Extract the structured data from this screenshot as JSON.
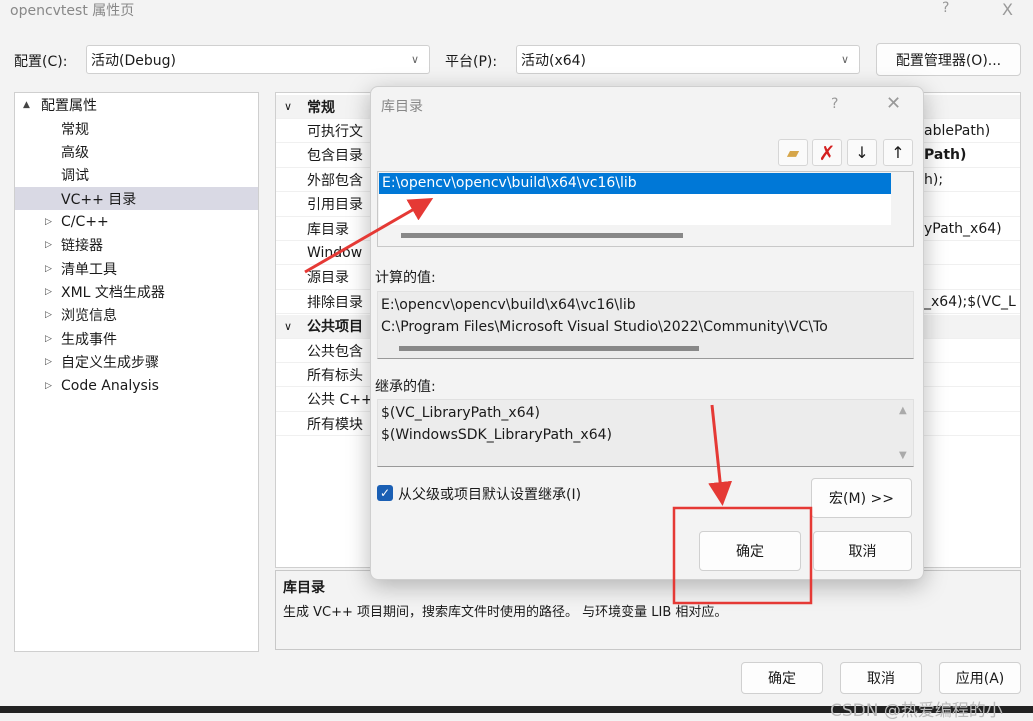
{
  "window": {
    "title": "opencvtest 属性页",
    "help": "?",
    "close": "X"
  },
  "toolbar": {
    "config_label": "配置(C):",
    "config_value": "活动(Debug)",
    "platform_label": "平台(P):",
    "platform_value": "活动(x64)",
    "config_manager": "配置管理器(O)..."
  },
  "tree": {
    "items": [
      {
        "label": "配置属性",
        "expander": "▲"
      },
      {
        "label": "常规",
        "expander": ""
      },
      {
        "label": "高级",
        "expander": ""
      },
      {
        "label": "调试",
        "expander": ""
      },
      {
        "label": "VC++ 目录",
        "expander": "",
        "selected": true
      },
      {
        "label": "C/C++",
        "expander": "▷"
      },
      {
        "label": "链接器",
        "expander": "▷"
      },
      {
        "label": "清单工具",
        "expander": "▷"
      },
      {
        "label": "XML 文档生成器",
        "expander": "▷"
      },
      {
        "label": "浏览信息",
        "expander": "▷"
      },
      {
        "label": "生成事件",
        "expander": "▷"
      },
      {
        "label": "自定义生成步骤",
        "expander": "▷"
      },
      {
        "label": "Code Analysis",
        "expander": "▷"
      }
    ]
  },
  "grid": {
    "rows": [
      {
        "name": "常规",
        "value": "",
        "header": true
      },
      {
        "name": "可执行文",
        "value": "ablePath)"
      },
      {
        "name": "包含目录",
        "value": "Path)",
        "bold": true
      },
      {
        "name": "外部包含",
        "value": "h);"
      },
      {
        "name": "引用目录",
        "value": ""
      },
      {
        "name": "库目录",
        "value": "yPath_x64)"
      },
      {
        "name": "Window",
        "value": ""
      },
      {
        "name": "源目录",
        "value": ""
      },
      {
        "name": "排除目录",
        "value": "_x64);$(VC_L"
      },
      {
        "name": "公共项目",
        "value": "",
        "header": true
      },
      {
        "name": "公共包含",
        "value": ""
      },
      {
        "name": "所有标头",
        "value": ""
      },
      {
        "name": "公共 C++",
        "value": ""
      },
      {
        "name": "所有模块",
        "value": ""
      }
    ]
  },
  "description": {
    "title": "库目录",
    "text": "生成 VC++ 项目期间，搜索库文件时使用的路径。 与环境变量 LIB 相对应。"
  },
  "buttons": {
    "ok": "确定",
    "cancel": "取消",
    "apply": "应用(A)"
  },
  "dialog": {
    "title": "库目录",
    "help": "?",
    "close": "✕",
    "entries": [
      "E:\\opencv\\opencv\\build\\x64\\vc16\\lib"
    ],
    "computed_label": "计算的值:",
    "computed": [
      "E:\\opencv\\opencv\\build\\x64\\vc16\\lib",
      "C:\\Program Files\\Microsoft Visual Studio\\2022\\Community\\VC\\To"
    ],
    "inherited_label": "继承的值:",
    "inherited": [
      "$(VC_LibraryPath_x64)",
      "$(WindowsSDK_LibraryPath_x64)"
    ],
    "inherit_checkbox": "从父级或项目默认设置继承(I)",
    "inherit_checked": true,
    "macro": "宏(M) >>",
    "ok": "确定",
    "cancel": "取消"
  },
  "watermark": "CSDN @热爱编程的小",
  "colors": {
    "selection": "#0078d7",
    "annotation": "#e53935",
    "tree_selected": "#d9d9e4"
  }
}
